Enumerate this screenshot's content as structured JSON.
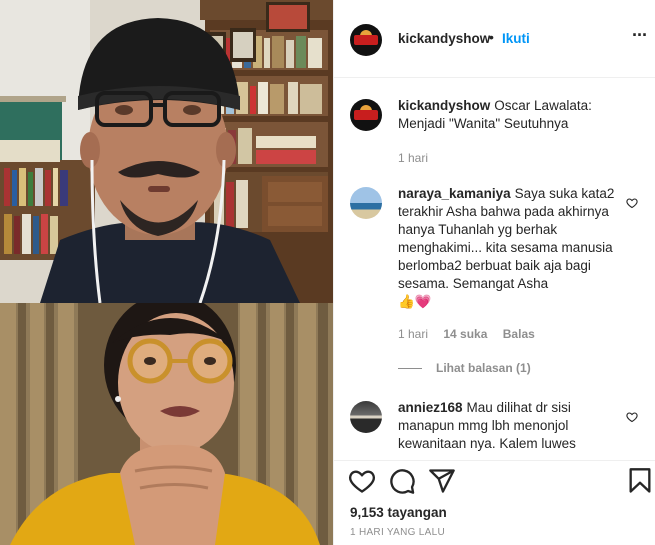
{
  "video": {
    "top_participant": "man-with-beanie",
    "bottom_participant": "woman-with-glasses"
  },
  "header": {
    "username": "kickandyshow",
    "separator": "•",
    "follow_label": "Ikuti",
    "more_icon": "more-horizontal-icon"
  },
  "caption": {
    "username": "kickandyshow",
    "text": "Oscar Lawalata: Menjadi \"Wanita\" Seutuhnya",
    "time": "1 hari"
  },
  "comments": [
    {
      "username": "naraya_kamaniya",
      "text": "Saya suka kata2 terakhir Asha bahwa pada akhirnya hanya Tuhanlah yg berhak menghakimi... kita sesama manusia berlomba2 berbuat baik aja bagi sesama. Semangat Asha",
      "emoji": "👍💗",
      "time": "1 hari",
      "likes": "14 suka",
      "reply_label": "Balas",
      "view_replies": "Lihat balasan (1)"
    },
    {
      "username": "anniez168",
      "text": "Mau dilihat dr sisi manapun mmg lbh menonjol kewanitaan nya. Kalem luwes"
    }
  ],
  "actions": {
    "like_icon": "heart-icon",
    "comment_icon": "comment-icon",
    "share_icon": "share-icon",
    "save_icon": "bookmark-icon",
    "views": "9,153 tayangan",
    "time_ago": "1 HARI YANG LALU"
  },
  "colors": {
    "follow_blue": "#0095f6",
    "muted_text": "#8e8e8e",
    "text": "#262626",
    "divider": "#efefef"
  }
}
